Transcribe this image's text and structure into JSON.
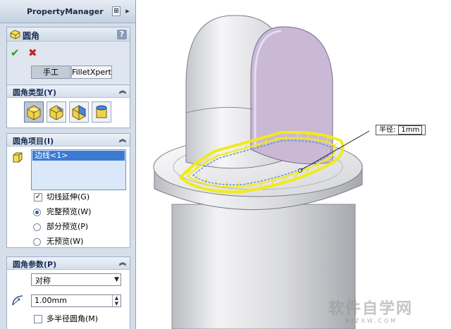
{
  "property_manager": {
    "title": "PropertyManager",
    "pin_glyph": "⊞",
    "close_glyph": "▸"
  },
  "feature": {
    "title": "圆角",
    "help": "?",
    "ok_glyph": "✔",
    "cancel_glyph": "✖",
    "tabs": [
      "手工",
      "FilletXpert"
    ]
  },
  "fillet_type": {
    "title": "圆角类型(Y)",
    "collapse_glyph": "︽",
    "options": [
      "constant-radius",
      "variable-radius",
      "face-fillet",
      "full-round"
    ],
    "selected_index": 0
  },
  "fillet_items": {
    "title": "圆角项目(I)",
    "collapse_glyph": "︽",
    "selection": [
      "边线<1>"
    ],
    "tangent_propagation": {
      "label": "切线延伸(G)",
      "checked": true,
      "check_glyph": "✓"
    },
    "preview": {
      "options": [
        "完整预览(W)",
        "部分预览(P)",
        "无预览(W)"
      ],
      "selected_index": 0
    }
  },
  "fillet_params": {
    "title": "圆角参数(P)",
    "collapse_glyph": "︽",
    "mode": "对称",
    "radius": "1.00mm",
    "multi_radius": {
      "label": "多半径圆角(M)",
      "checked": false
    }
  },
  "viewport": {
    "callout_label": "半径:",
    "callout_value": "1mm",
    "watermark_cn": "软件自学网",
    "watermark_en": "RJZXW.COM",
    "colors": {
      "body": "#d9dadd",
      "inner_face": "#c9b9d6",
      "fillet_preview": "#f2ea1c",
      "selected_edge": "#4a7fd6"
    }
  }
}
